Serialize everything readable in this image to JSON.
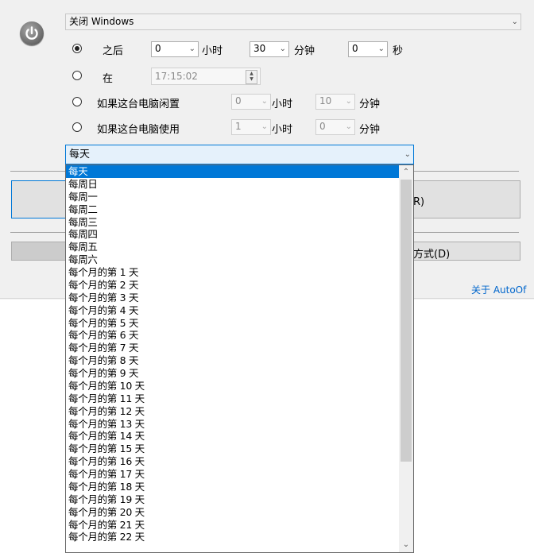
{
  "power_icon": "power-icon",
  "action_select": {
    "value": "关闭 Windows"
  },
  "after_row": {
    "label": "之后",
    "hours": "0",
    "hours_unit": "小时",
    "minutes": "30",
    "minutes_unit": "分钟",
    "seconds": "0",
    "seconds_unit": "秒"
  },
  "at_row": {
    "label": "在",
    "time": "17:15:02"
  },
  "idle_row": {
    "label": "如果这台电脑闲置",
    "hours": "0",
    "hours_unit": "小时",
    "minutes": "10",
    "minutes_unit": "分钟"
  },
  "use_row": {
    "label": "如果这台电脑使用",
    "hours": "1",
    "hours_unit": "小时",
    "minutes": "0",
    "minutes_unit": "分钟"
  },
  "repeat_select": {
    "value": "每天"
  },
  "repeat_options": [
    "每天",
    "每周日",
    "每周一",
    "每周二",
    "每周三",
    "每周四",
    "每周五",
    "每周六",
    "每个月的第 1 天",
    "每个月的第 2 天",
    "每个月的第 3 天",
    "每个月的第 4 天",
    "每个月的第 5 天",
    "每个月的第 6 天",
    "每个月的第 7 天",
    "每个月的第 8 天",
    "每个月的第 9 天",
    "每个月的第 10 天",
    "每个月的第 11 天",
    "每个月的第 12 天",
    "每个月的第 13 天",
    "每个月的第 14 天",
    "每个月的第 15 天",
    "每个月的第 16 天",
    "每个月的第 17 天",
    "每个月的第 18 天",
    "每个月的第 19 天",
    "每个月的第 20 天",
    "每个月的第 21 天",
    "每个月的第 22 天"
  ],
  "partial_button_1": "R)",
  "partial_button_2": "方式(D)",
  "about_link": "关于 AutoOf"
}
